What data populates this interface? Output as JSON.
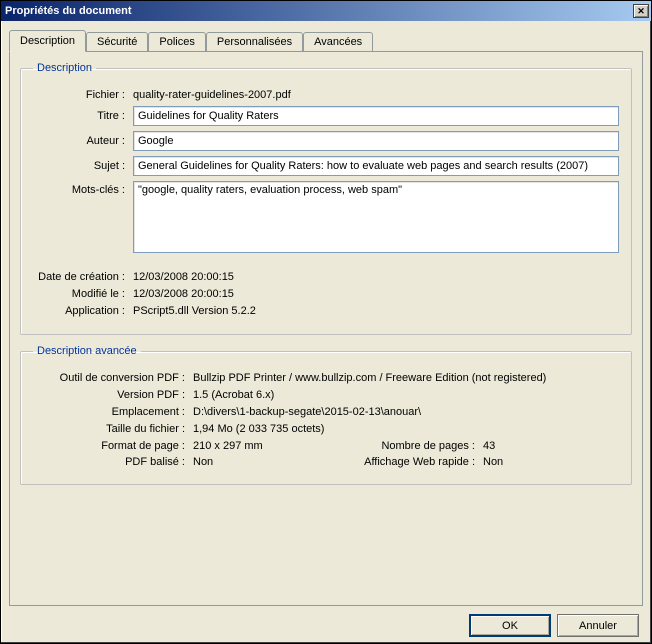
{
  "window": {
    "title": "Propriétés du document"
  },
  "tabs": {
    "description": "Description",
    "securite": "Sécurité",
    "polices": "Polices",
    "personnalisees": "Personnalisées",
    "avancees": "Avancées"
  },
  "group1": {
    "legend": "Description",
    "file_label": "Fichier :",
    "file_value": "quality-rater-guidelines-2007.pdf",
    "title_label": "Titre :",
    "title_value": "Guidelines for Quality Raters",
    "author_label": "Auteur :",
    "author_value": "Google",
    "subject_label": "Sujet :",
    "subject_value": "General Guidelines for Quality Raters: how to evaluate web pages and search results (2007)",
    "keywords_label": "Mots-clés :",
    "keywords_value": "\"google, quality raters, evaluation process, web spam\"",
    "created_label": "Date de création :",
    "created_value": "12/03/2008 20:00:15",
    "modified_label": "Modifié le :",
    "modified_value": "12/03/2008 20:00:15",
    "application_label": "Application :",
    "application_value": "PScript5.dll Version 5.2.2"
  },
  "group2": {
    "legend": "Description avancée",
    "producer_label": "Outil de conversion PDF :",
    "producer_value": "Bullzip PDF Printer / www.bullzip.com / Freeware Edition (not registered)",
    "pdfver_label": "Version PDF :",
    "pdfver_value": "1.5 (Acrobat 6.x)",
    "location_label": "Emplacement :",
    "location_value": "D:\\divers\\1-backup-segate\\2015-02-13\\anouar\\",
    "filesize_label": "Taille du fichier :",
    "filesize_value": "1,94 Mo (2 033 735 octets)",
    "pagesize_label": "Format de page :",
    "pagesize_value": "210 x 297 mm",
    "pagecount_label": "Nombre de pages :",
    "pagecount_value": "43",
    "tagged_label": "PDF balisé :",
    "tagged_value": "Non",
    "fastweb_label": "Affichage Web rapide :",
    "fastweb_value": "Non"
  },
  "buttons": {
    "ok": "OK",
    "cancel": "Annuler"
  }
}
